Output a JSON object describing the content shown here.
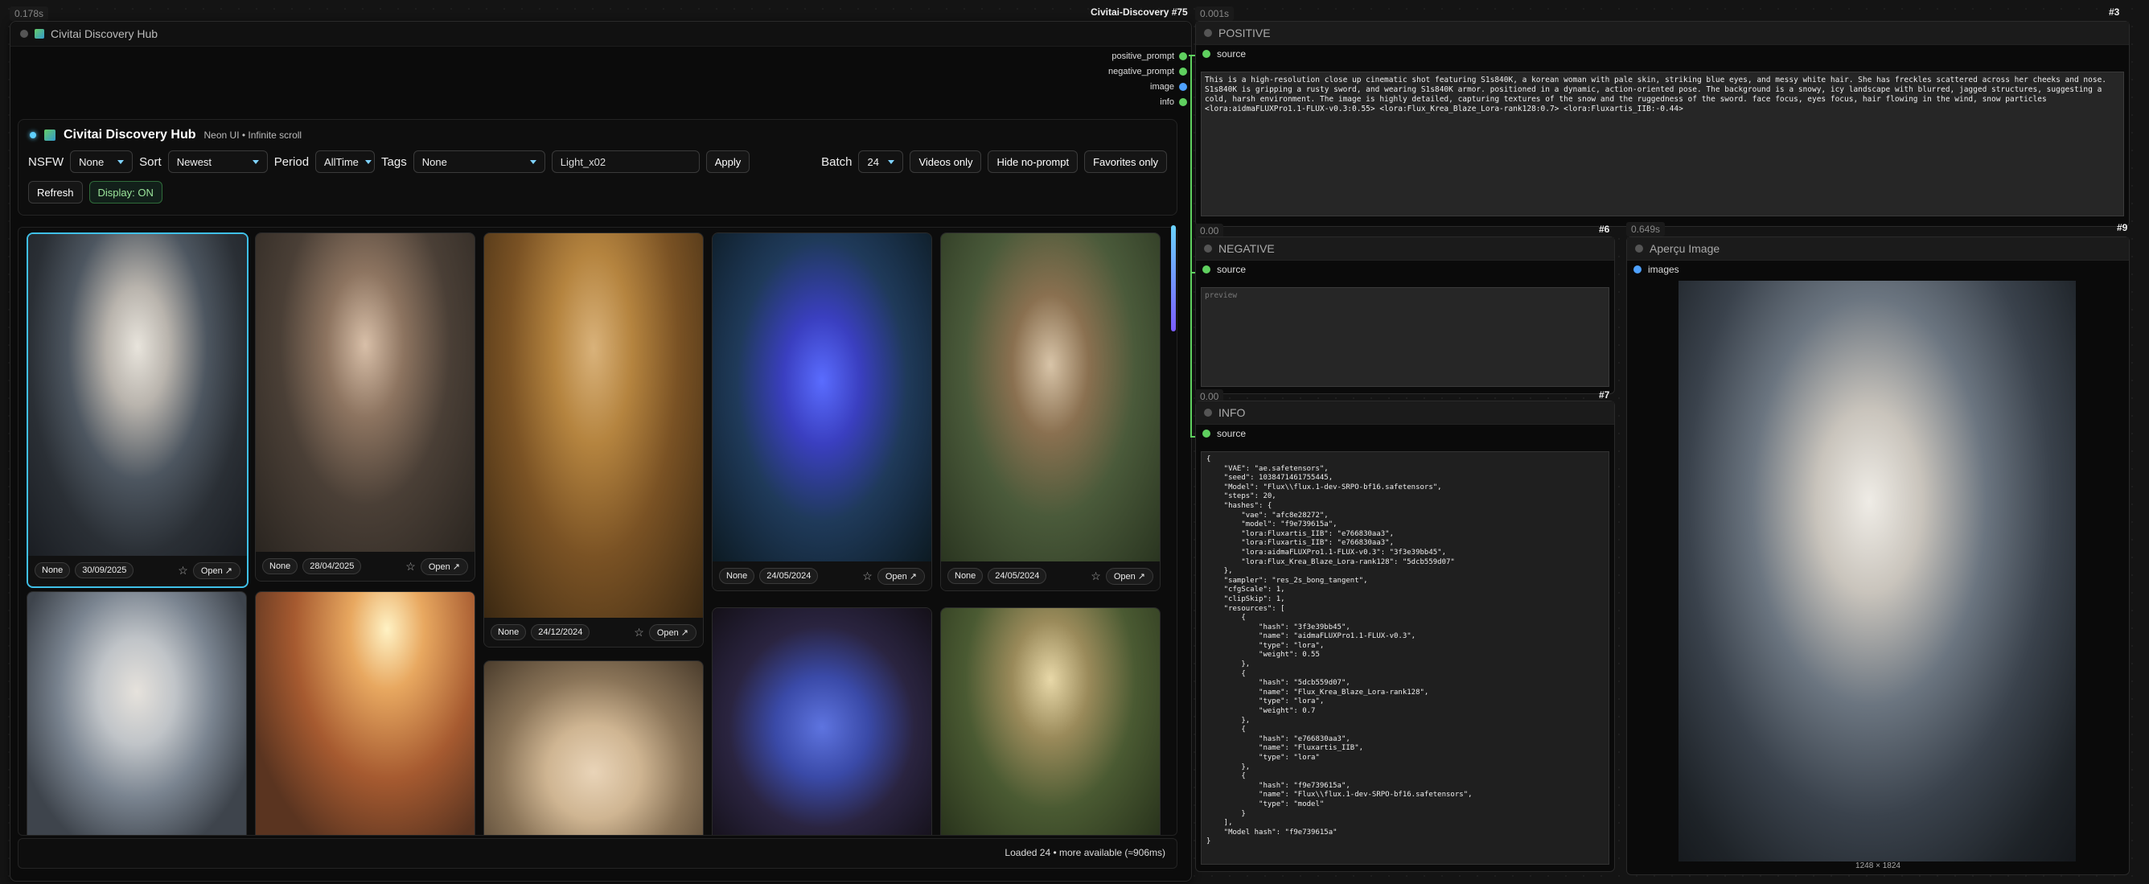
{
  "timings": {
    "main": "0.178s",
    "positive": "0.001s",
    "preview": "0.649s",
    "negative": "0.00",
    "info": "0.00"
  },
  "node_badges": {
    "main": "Civitai-Discovery #75",
    "positive": "#3",
    "preview": "#9",
    "negative": "#6",
    "info": "#7"
  },
  "main_node": {
    "title": "Civitai Discovery Hub",
    "outputs": [
      "positive_prompt",
      "negative_prompt",
      "image",
      "info"
    ]
  },
  "hub": {
    "title": "Civitai Discovery Hub",
    "subtitle": "Neon UI • Infinite scroll",
    "nsfw_label": "NSFW",
    "nsfw_value": "None",
    "sort_label": "Sort",
    "sort_value": "Newest",
    "period_label": "Period",
    "period_value": "AllTime",
    "tags_label": "Tags",
    "tags_value": "None",
    "search_value": "Light_x02",
    "apply_label": "Apply",
    "batch_label": "Batch",
    "batch_value": "24",
    "videos_only": "Videos only",
    "hide_no_prompt": "Hide no-prompt",
    "favorites_only": "Favorites only",
    "refresh": "Refresh",
    "display": "Display: ON",
    "status": "Loaded 24 • more available (≈906ms)"
  },
  "cards": [
    {
      "nsfw": "None",
      "date": "30/09/2025",
      "open": "Open ↗"
    },
    {
      "nsfw": "None",
      "date": "28/04/2025",
      "open": "Open ↗"
    },
    {
      "nsfw": "None",
      "date": "24/12/2024",
      "open": "Open ↗"
    },
    {
      "nsfw": "None",
      "date": "24/05/2024",
      "open": "Open ↗"
    },
    {
      "nsfw": "None",
      "date": "24/05/2024",
      "open": "Open ↗"
    }
  ],
  "positive": {
    "title": "POSITIVE",
    "source": "source",
    "text": "This is a high-resolution close up cinematic shot featuring S1s840K, a korean woman with pale skin, striking blue eyes, and messy white hair. She has freckles scattered across her cheeks and nose. S1s840K is gripping a rusty sword, and wearing S1s840K armor. positioned in a dynamic, action-oriented pose. The background is a snowy, icy landscape with blurred, jagged structures, suggesting a cold, harsh environment. The image is highly detailed, capturing textures of the snow and the ruggedness of the sword. face focus, eyes focus, hair flowing in the wind, snow particles <lora:aidmaFLUXPro1.1-FLUX-v0.3:0.55> <lora:Flux_Krea_Blaze_Lora-rank128:0.7> <lora:Fluxartis_IIB:-0.44>"
  },
  "negative": {
    "title": "NEGATIVE",
    "source": "source",
    "placeholder": "preview"
  },
  "info": {
    "title": "INFO",
    "source": "source",
    "text": "{\n    \"VAE\": \"ae.safetensors\",\n    \"seed\": 1038471461755445,\n    \"Model\": \"Flux\\\\flux.1-dev-SRPO-bf16.safetensors\",\n    \"steps\": 20,\n    \"hashes\": {\n        \"vae\": \"afc8e28272\",\n        \"model\": \"f9e739615a\",\n        \"lora:Fluxartis_IIB\": \"e766830aa3\",\n        \"lora:Fluxartis_IIB\": \"e766830aa3\",\n        \"lora:aidmaFLUXPro1.1-FLUX-v0.3\": \"3f3e39bb45\",\n        \"lora:Flux_Krea_Blaze_Lora-rank128\": \"5dcb559d07\"\n    },\n    \"sampler\": \"res_2s_bong_tangent\",\n    \"cfgScale\": 1,\n    \"clipSkip\": 1,\n    \"resources\": [\n        {\n            \"hash\": \"3f3e39bb45\",\n            \"name\": \"aidmaFLUXPro1.1-FLUX-v0.3\",\n            \"type\": \"lora\",\n            \"weight\": 0.55\n        },\n        {\n            \"hash\": \"5dcb559d07\",\n            \"name\": \"Flux_Krea_Blaze_Lora-rank128\",\n            \"type\": \"lora\",\n            \"weight\": 0.7\n        },\n        {\n            \"hash\": \"e766830aa3\",\n            \"name\": \"Fluxartis_IIB\",\n            \"type\": \"lora\"\n        },\n        {\n            \"hash\": \"f9e739615a\",\n            \"name\": \"Flux\\\\flux.1-dev-SRPO-bf16.safetensors\",\n            \"type\": \"model\"\n        }\n    ],\n    \"Model hash\": \"f9e739615a\"\n}"
  },
  "preview": {
    "title": "Aperçu Image",
    "input": "images",
    "dims": "1248 × 1824"
  }
}
